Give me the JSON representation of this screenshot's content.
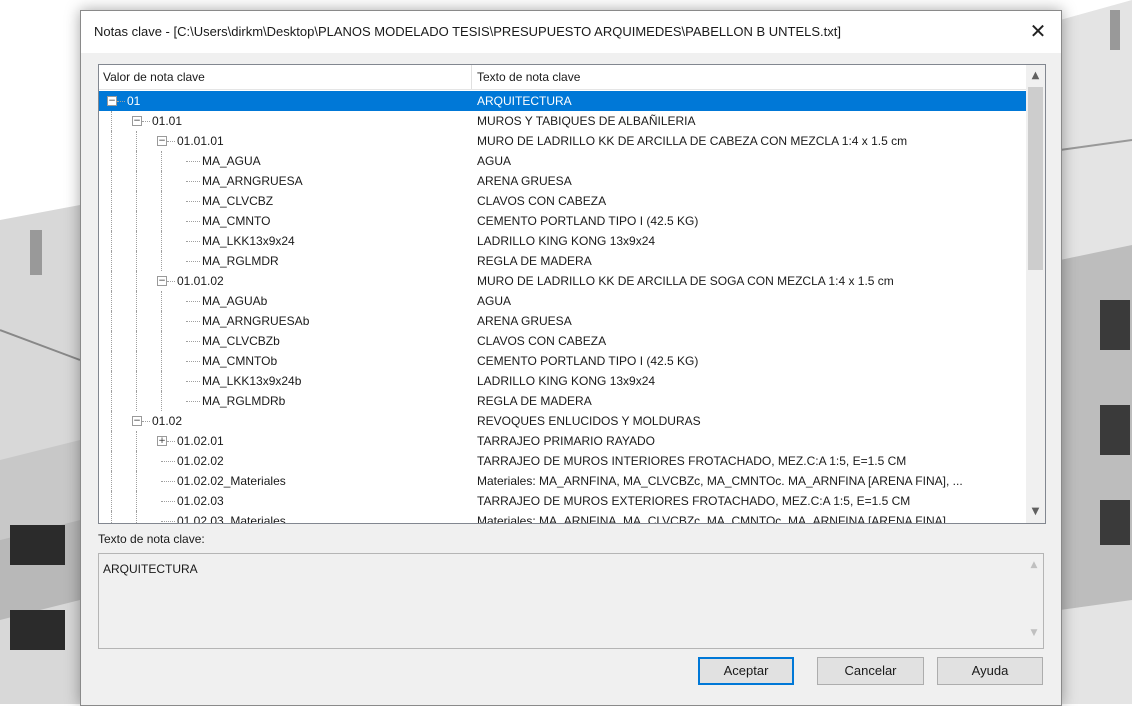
{
  "dialog": {
    "title": "Notas clave - [C:\\Users\\dirkm\\Desktop\\PLANOS MODELADO TESIS\\PRESUPUESTO ARQUIMEDES\\PABELLON B UNTELS.txt]",
    "close_glyph": "✕"
  },
  "grid": {
    "columns": [
      "Valor de nota clave",
      "Texto de nota clave"
    ],
    "rows": [
      {
        "key": "01",
        "text": "ARQUITECTURA",
        "level": 0,
        "expander": "−",
        "selected": true
      },
      {
        "key": "01.01",
        "text": "MUROS Y TABIQUES DE ALBAÑILERIA",
        "level": 1,
        "expander": "−"
      },
      {
        "key": "01.01.01",
        "text": "MURO DE LADRILLO KK DE ARCILLA DE CABEZA CON MEZCLA 1:4 x 1.5 cm",
        "level": 2,
        "expander": "−"
      },
      {
        "key": "MA_AGUA",
        "text": "AGUA",
        "level": 3
      },
      {
        "key": "MA_ARNGRUESA",
        "text": "ARENA GRUESA",
        "level": 3
      },
      {
        "key": "MA_CLVCBZ",
        "text": "CLAVOS CON CABEZA",
        "level": 3
      },
      {
        "key": "MA_CMNTO",
        "text": "CEMENTO PORTLAND TIPO I (42.5 KG)",
        "level": 3
      },
      {
        "key": "MA_LKK13x9x24",
        "text": "LADRILLO KING KONG 13x9x24",
        "level": 3
      },
      {
        "key": "MA_RGLMDR",
        "text": "REGLA DE MADERA",
        "level": 3
      },
      {
        "key": "01.01.02",
        "text": "MURO DE LADRILLO KK DE ARCILLA DE SOGA CON MEZCLA 1:4 x 1.5 cm",
        "level": 2,
        "expander": "−"
      },
      {
        "key": "MA_AGUAb",
        "text": "AGUA",
        "level": 3
      },
      {
        "key": "MA_ARNGRUESAb",
        "text": "ARENA GRUESA",
        "level": 3
      },
      {
        "key": "MA_CLVCBZb",
        "text": "CLAVOS CON CABEZA",
        "level": 3
      },
      {
        "key": "MA_CMNTOb",
        "text": "CEMENTO PORTLAND TIPO I (42.5 KG)",
        "level": 3
      },
      {
        "key": "MA_LKK13x9x24b",
        "text": "LADRILLO KING KONG 13x9x24",
        "level": 3
      },
      {
        "key": "MA_RGLMDRb",
        "text": "REGLA DE MADERA",
        "level": 3
      },
      {
        "key": "01.02",
        "text": "REVOQUES ENLUCIDOS Y MOLDURAS",
        "level": 1,
        "expander": "−"
      },
      {
        "key": "01.02.01",
        "text": "TARRAJEO PRIMARIO RAYADO",
        "level": 2,
        "expander": "+"
      },
      {
        "key": "01.02.02",
        "text": "TARRAJEO DE MUROS INTERIORES FROTACHADO, MEZ.C:A 1:5, E=1.5 CM",
        "level": 2
      },
      {
        "key": "01.02.02_Materiales",
        "text": "Materiales: MA_ARNFINA, MA_CLVCBZc, MA_CMNTOc. MA_ARNFINA [ARENA FINA], ...",
        "level": 2
      },
      {
        "key": "01.02.03",
        "text": "TARRAJEO DE MUROS EXTERIORES FROTACHADO, MEZ.C:A 1:5, E=1.5 CM",
        "level": 2
      },
      {
        "key": "01.02.03_Materiales",
        "text": "Materiales: MA_ARNFINA, MA_CLVCBZc, MA_CMNTOc. MA_ARNFINA [ARENA FINA]",
        "level": 2
      }
    ]
  },
  "detail": {
    "label": "Texto de nota clave:",
    "value": "ARQUITECTURA"
  },
  "buttons": {
    "ok": "Aceptar",
    "cancel": "Cancelar",
    "help": "Ayuda"
  },
  "colors": {
    "selection": "#0078d7",
    "dialog_bg": "#f0f0f0",
    "default_button_border": "#0078d7"
  }
}
